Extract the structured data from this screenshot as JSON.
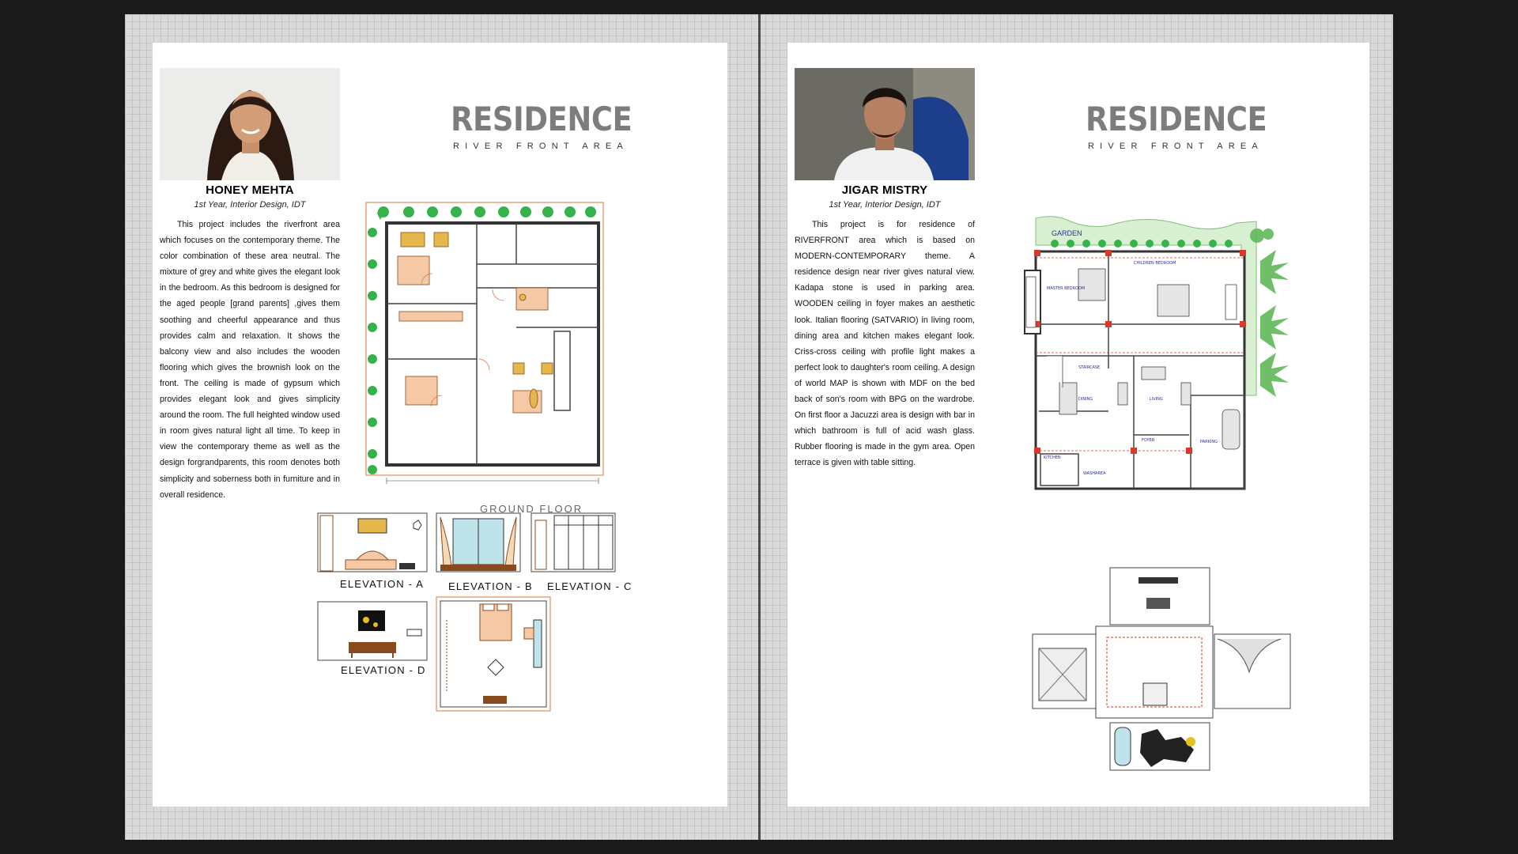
{
  "left_page": {
    "person_name": "HONEY MEHTA",
    "person_role": "1st Year, Interior Design, IDT",
    "description": "This project includes the riverfront area which focuses on the contemporary theme. The color combination of these area neutral. The mixture of grey and white gives the elegant look in the bedroom. As this bedroom is designed for the aged people [grand parents] ,gives them soothing and cheerful appearance and thus provides calm and relaxation. It shows the balcony view and also includes the wooden flooring which gives the brownish look on the front. The ceiling is made of gypsum which provides elegant look and gives simplicity around the room. The full heighted window used in room gives natural light all time. To keep in view the contemporary theme as well as the design forgrandparents, this room denotes both simplicity and soberness both in furniture and in overall residence.",
    "title": "RESIDENCE",
    "subtitle": "RIVER FRONT AREA",
    "plan_label": "GROUND FLOOR",
    "elevations": {
      "a": "ELEVATION - A",
      "b": "ELEVATION - B",
      "c": "ELEVATION - C",
      "d": "ELEVATION - D"
    }
  },
  "right_page": {
    "person_name": "JIGAR MISTRY",
    "person_role": "1st Year, Interior Design, IDT",
    "description": "This project is for residence of RIVERFRONT area which is based on MODERN-CONTEMPORARY theme. A residence design near river gives natural view. Kadapa stone is used in parking area. WOODEN ceiling in foyer makes an aesthetic look. Italian flooring (SATVARIO) in living room, dining area and kitchen makes elegant look. Criss-cross ceiling with profile light makes a perfect look to daughter's room ceiling. A design of world MAP is shown with MDF on the bed back of son's room with BPG on the wardrobe. On first floor a Jacuzzi area is design with bar in which bathroom is full of acid wash glass. Rubber flooring is made in the gym area. Open terrace is given with table sitting.",
    "title": "RESIDENCE",
    "subtitle": "RIVER FRONT AREA",
    "plan_labels": {
      "garden": "GARDEN",
      "master_bedroom": "MASTER BEDROOM",
      "children_bedroom": "CHILDREN BEDROOM",
      "staircase": "STAIRCASE",
      "living": "LIVING",
      "dining": "DINING",
      "kitchen": "KITCHEN",
      "foyer": "FOYER",
      "parking": "PARKING",
      "washarea": "WASHAREA"
    }
  },
  "colors": {
    "plan_red": "#d83a2a",
    "plant_green": "#36b24a",
    "wood_brown": "#8a4a1e",
    "label_blue": "#2a2f8f",
    "title_grey": "#7d7d7d"
  }
}
